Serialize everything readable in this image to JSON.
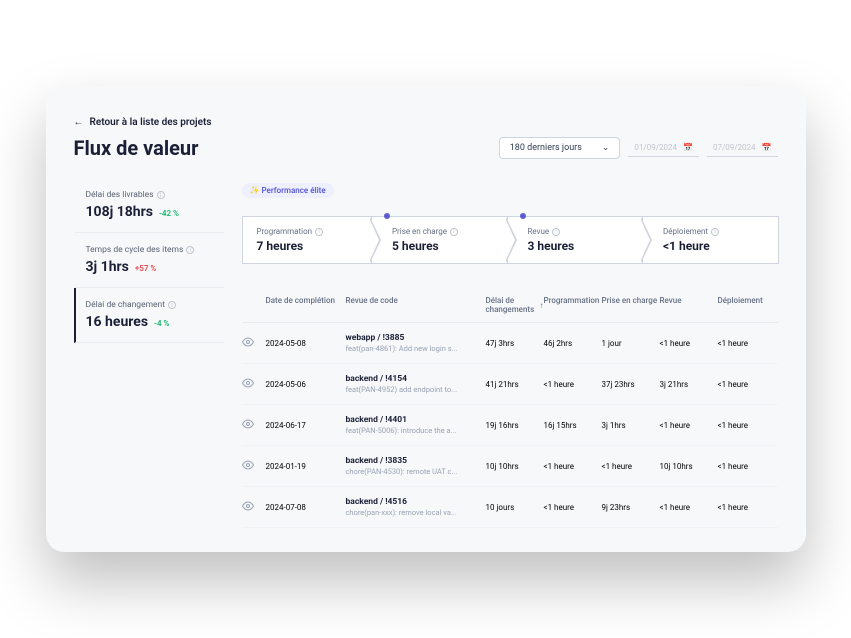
{
  "back_link": "Retour à la liste des projets",
  "page_title": "Flux de valeur",
  "period_dropdown": "180 derniers jours",
  "date_from": "01/09/2024",
  "date_to": "07/09/2024",
  "sidebar": [
    {
      "label": "Délai des livrables",
      "value": "108j 18hrs",
      "delta": "-42 %",
      "delta_class": "pos",
      "active": false
    },
    {
      "label": "Temps de cycle des items",
      "value": "3j 1hrs",
      "delta": "+57 %",
      "delta_class": "neg",
      "active": false
    },
    {
      "label": "Délai de changement",
      "value": "16 heures",
      "delta": "-4 %",
      "delta_class": "pos",
      "active": true
    }
  ],
  "badge": "✨ Performance élite",
  "stages": [
    {
      "label": "Programmation",
      "value": "7 heures"
    },
    {
      "label": "Prise en charge",
      "value": "5 heures"
    },
    {
      "label": "Revue",
      "value": "3 heures"
    },
    {
      "label": "Déploiement",
      "value": "<1 heure"
    }
  ],
  "columns": {
    "date": "Date de complétion",
    "review": "Revue de code",
    "delai": "Délai de changements",
    "prog": "Programmation",
    "prise": "Prise en charge",
    "revue": "Revue",
    "deploy": "Déploiement"
  },
  "rows": [
    {
      "date": "2024-05-08",
      "title": "webapp / !3885",
      "sub": "feat(pan-4861): Add new login s...",
      "delai": "47j 3hrs",
      "prog": "46j 2hrs",
      "prise": "1 jour",
      "revue": "<1 heure",
      "deploy": "<1 heure"
    },
    {
      "date": "2024-05-06",
      "title": "backend / !4154",
      "sub": "feat(PAN-4952) add endpoint to...",
      "delai": "41j 21hrs",
      "prog": "<1 heure",
      "prise": "37j 23hrs",
      "revue": "3j 21hrs",
      "deploy": "<1 heure"
    },
    {
      "date": "2024-06-17",
      "title": "backend / !4401",
      "sub": "feat(PAN-5006): introduce the a...",
      "delai": "19j 16hrs",
      "prog": "16j 15hrs",
      "prise": "3j 1hrs",
      "revue": "<1 heure",
      "deploy": "<1 heure"
    },
    {
      "date": "2024-01-19",
      "title": "backend / !3835",
      "sub": "chore(PAN-4530): remote UAT c...",
      "delai": "10j 10hrs",
      "prog": "<1 heure",
      "prise": "<1 heure",
      "revue": "10j 10hrs",
      "deploy": "<1 heure"
    },
    {
      "date": "2024-07-08",
      "title": "backend / !4516",
      "sub": "chore(pan-xxx): remove local va...",
      "delai": "10 jours",
      "prog": "<1 heure",
      "prise": "9j 23hrs",
      "revue": "<1 heure",
      "deploy": "<1 heure"
    }
  ]
}
